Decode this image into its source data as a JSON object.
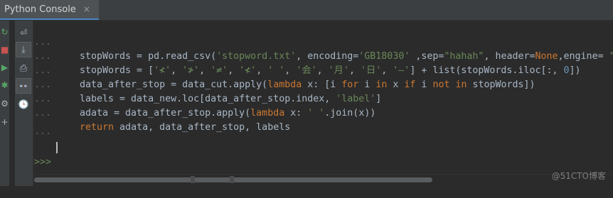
{
  "tab": {
    "title": "Python Console",
    "close": "×"
  },
  "side_stripe": [
    {
      "icon": "rerun-icon",
      "glyph": "↻",
      "color": "#59a869"
    },
    {
      "icon": "stop-icon",
      "glyph": "■",
      "color": "#c75450"
    },
    {
      "icon": "run-icon",
      "glyph": "▶",
      "color": "#59a869"
    },
    {
      "icon": "debug-icon",
      "glyph": "✱",
      "color": "#59a869"
    },
    {
      "icon": "settings-icon",
      "glyph": "⚙",
      "color": "#afb1b3"
    },
    {
      "icon": "add-icon",
      "glyph": "+",
      "color": "#afb1b3"
    }
  ],
  "toolbar": [
    {
      "icon": "soft-wrap-icon",
      "glyph": "⏎"
    },
    {
      "icon": "scroll-to-end-icon",
      "glyph": "⤓"
    },
    {
      "icon": "print-icon",
      "glyph": "⎙"
    },
    {
      "icon": "show-variables-icon",
      "glyph": "👓"
    },
    {
      "icon": "history-icon",
      "glyph": "🕒"
    }
  ],
  "console": {
    "continuation": "...",
    "prompt": ">>>",
    "lines": [
      "stopWords = pd.read_csv('stopword.txt', encoding='GB18030' ,sep=\"hahah\", header=None,engine= \"",
      "stopWords = ['≮', '≯', '≠', '≮', ' ', '会', '月', '日', '–'] + list(stopWords.iloc[:, 0])",
      "data_after_stop = data_cut.apply(lambda x: [i for i in x if i not in stopWords])",
      "labels = data_new.loc[data_after_stop.index, 'label']",
      "adata = data_after_stop.apply(lambda x: ' '.join(x))",
      "return adata, data_after_stop, labels"
    ]
  },
  "watermark": "@51CTO博客"
}
